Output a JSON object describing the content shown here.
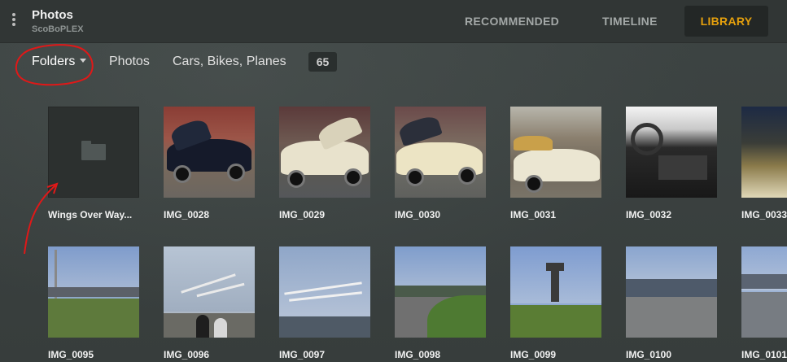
{
  "app": {
    "title": "Photos",
    "server": "ScoBoPLEX"
  },
  "nav": {
    "tabs": [
      {
        "label": "RECOMMENDED"
      },
      {
        "label": "TIMELINE"
      },
      {
        "label": "LIBRARY"
      }
    ],
    "active": "LIBRARY",
    "accent": "#e5a00d"
  },
  "breadcrumb": {
    "folders_label": "Folders",
    "photos_label": "Photos",
    "album_label": "Cars, Bikes, Planes",
    "count": "65"
  },
  "items": [
    {
      "label": "Wings Over Way..."
    },
    {
      "label": "IMG_0028"
    },
    {
      "label": "IMG_0029"
    },
    {
      "label": "IMG_0030"
    },
    {
      "label": "IMG_0031"
    },
    {
      "label": "IMG_0032"
    },
    {
      "label": "IMG_0033"
    },
    {
      "label": "IMG_0095"
    },
    {
      "label": "IMG_0096"
    },
    {
      "label": "IMG_0097"
    },
    {
      "label": "IMG_0098"
    },
    {
      "label": "IMG_0099"
    },
    {
      "label": "IMG_0100"
    },
    {
      "label": "IMG_0101"
    }
  ],
  "icons": {
    "menu": "kebab-menu-icon",
    "folder": "folder-icon",
    "dropdown": "caret-down-icon"
  }
}
